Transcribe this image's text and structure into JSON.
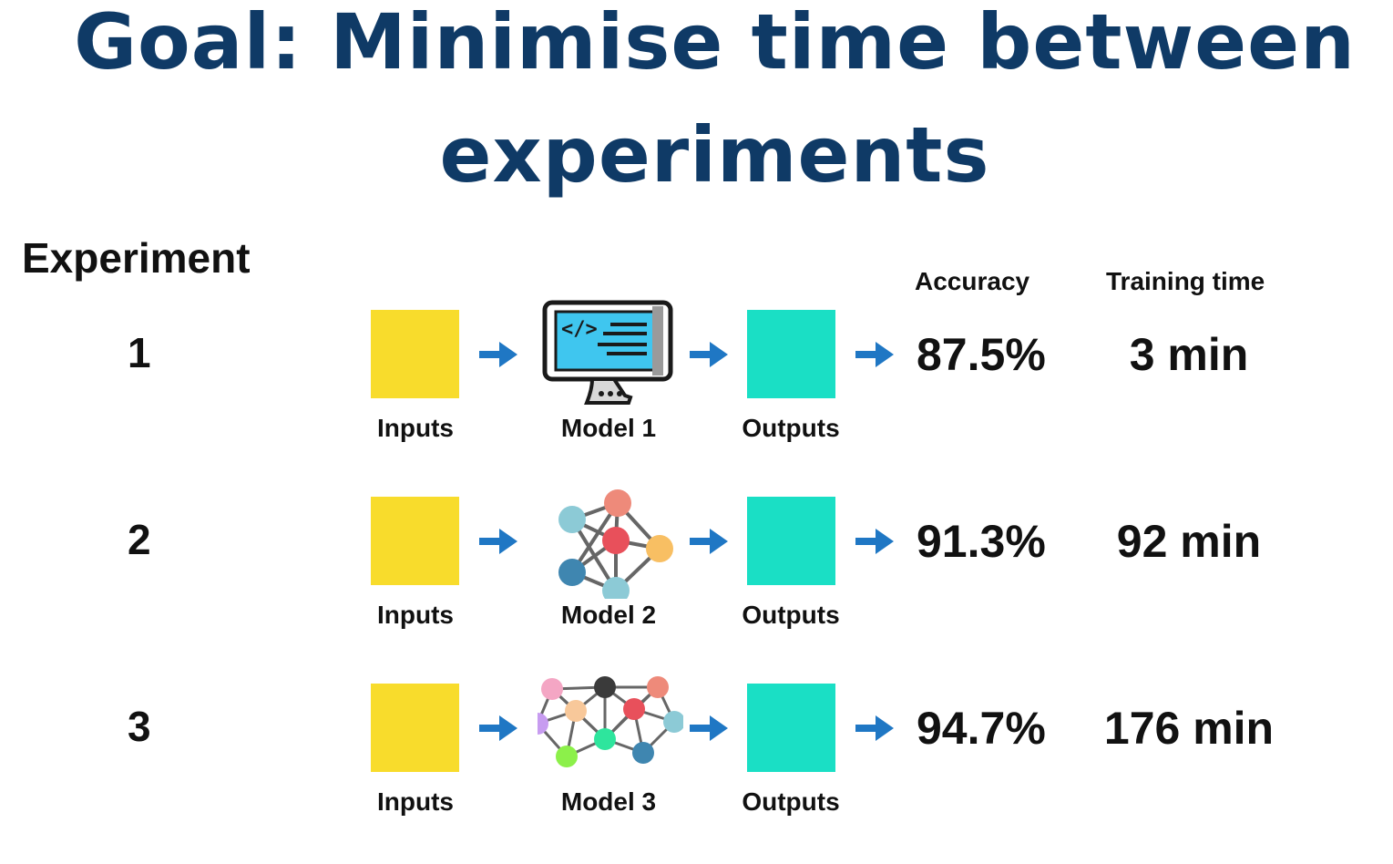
{
  "title": {
    "line1": "Goal: Minimise time between",
    "line2": "experiments"
  },
  "headers": {
    "experiment": "Experiment",
    "accuracy": "Accuracy",
    "training_time": "Training time"
  },
  "rows": [
    {
      "number": "1",
      "input_label": "Inputs",
      "model_label": "Model 1",
      "output_label": "Outputs",
      "accuracy": "87.5%",
      "training_time": "3 min",
      "model_icon": "computer-code-icon"
    },
    {
      "number": "2",
      "input_label": "Inputs",
      "model_label": "Model 2",
      "output_label": "Outputs",
      "accuracy": "91.3%",
      "training_time": "92 min",
      "model_icon": "small-neural-network-icon"
    },
    {
      "number": "3",
      "input_label": "Inputs",
      "model_label": "Model 3",
      "output_label": "Outputs",
      "accuracy": "94.7%",
      "training_time": "176 min",
      "model_icon": "large-neural-network-icon"
    }
  ],
  "colors": {
    "title": "#0f3a66",
    "inputs_box": "#f8dc2c",
    "outputs_box": "#1adfc5",
    "arrow": "#1f77c4"
  }
}
